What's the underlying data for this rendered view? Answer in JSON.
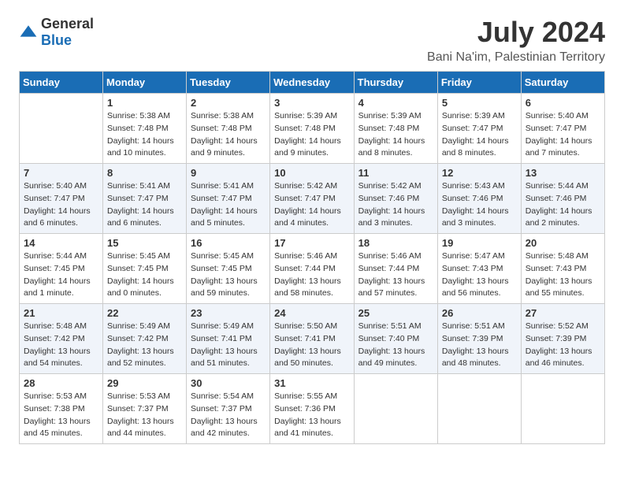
{
  "logo": {
    "general": "General",
    "blue": "Blue"
  },
  "title": "July 2024",
  "subtitle": "Bani Na'im, Palestinian Territory",
  "days_of_week": [
    "Sunday",
    "Monday",
    "Tuesday",
    "Wednesday",
    "Thursday",
    "Friday",
    "Saturday"
  ],
  "weeks": [
    {
      "shaded": false,
      "days": [
        {
          "num": "",
          "info": ""
        },
        {
          "num": "1",
          "info": "Sunrise: 5:38 AM\nSunset: 7:48 PM\nDaylight: 14 hours\nand 10 minutes."
        },
        {
          "num": "2",
          "info": "Sunrise: 5:38 AM\nSunset: 7:48 PM\nDaylight: 14 hours\nand 9 minutes."
        },
        {
          "num": "3",
          "info": "Sunrise: 5:39 AM\nSunset: 7:48 PM\nDaylight: 14 hours\nand 9 minutes."
        },
        {
          "num": "4",
          "info": "Sunrise: 5:39 AM\nSunset: 7:48 PM\nDaylight: 14 hours\nand 8 minutes."
        },
        {
          "num": "5",
          "info": "Sunrise: 5:39 AM\nSunset: 7:47 PM\nDaylight: 14 hours\nand 8 minutes."
        },
        {
          "num": "6",
          "info": "Sunrise: 5:40 AM\nSunset: 7:47 PM\nDaylight: 14 hours\nand 7 minutes."
        }
      ]
    },
    {
      "shaded": true,
      "days": [
        {
          "num": "7",
          "info": "Sunrise: 5:40 AM\nSunset: 7:47 PM\nDaylight: 14 hours\nand 6 minutes."
        },
        {
          "num": "8",
          "info": "Sunrise: 5:41 AM\nSunset: 7:47 PM\nDaylight: 14 hours\nand 6 minutes."
        },
        {
          "num": "9",
          "info": "Sunrise: 5:41 AM\nSunset: 7:47 PM\nDaylight: 14 hours\nand 5 minutes."
        },
        {
          "num": "10",
          "info": "Sunrise: 5:42 AM\nSunset: 7:47 PM\nDaylight: 14 hours\nand 4 minutes."
        },
        {
          "num": "11",
          "info": "Sunrise: 5:42 AM\nSunset: 7:46 PM\nDaylight: 14 hours\nand 3 minutes."
        },
        {
          "num": "12",
          "info": "Sunrise: 5:43 AM\nSunset: 7:46 PM\nDaylight: 14 hours\nand 3 minutes."
        },
        {
          "num": "13",
          "info": "Sunrise: 5:44 AM\nSunset: 7:46 PM\nDaylight: 14 hours\nand 2 minutes."
        }
      ]
    },
    {
      "shaded": false,
      "days": [
        {
          "num": "14",
          "info": "Sunrise: 5:44 AM\nSunset: 7:45 PM\nDaylight: 14 hours\nand 1 minute."
        },
        {
          "num": "15",
          "info": "Sunrise: 5:45 AM\nSunset: 7:45 PM\nDaylight: 14 hours\nand 0 minutes."
        },
        {
          "num": "16",
          "info": "Sunrise: 5:45 AM\nSunset: 7:45 PM\nDaylight: 13 hours\nand 59 minutes."
        },
        {
          "num": "17",
          "info": "Sunrise: 5:46 AM\nSunset: 7:44 PM\nDaylight: 13 hours\nand 58 minutes."
        },
        {
          "num": "18",
          "info": "Sunrise: 5:46 AM\nSunset: 7:44 PM\nDaylight: 13 hours\nand 57 minutes."
        },
        {
          "num": "19",
          "info": "Sunrise: 5:47 AM\nSunset: 7:43 PM\nDaylight: 13 hours\nand 56 minutes."
        },
        {
          "num": "20",
          "info": "Sunrise: 5:48 AM\nSunset: 7:43 PM\nDaylight: 13 hours\nand 55 minutes."
        }
      ]
    },
    {
      "shaded": true,
      "days": [
        {
          "num": "21",
          "info": "Sunrise: 5:48 AM\nSunset: 7:42 PM\nDaylight: 13 hours\nand 54 minutes."
        },
        {
          "num": "22",
          "info": "Sunrise: 5:49 AM\nSunset: 7:42 PM\nDaylight: 13 hours\nand 52 minutes."
        },
        {
          "num": "23",
          "info": "Sunrise: 5:49 AM\nSunset: 7:41 PM\nDaylight: 13 hours\nand 51 minutes."
        },
        {
          "num": "24",
          "info": "Sunrise: 5:50 AM\nSunset: 7:41 PM\nDaylight: 13 hours\nand 50 minutes."
        },
        {
          "num": "25",
          "info": "Sunrise: 5:51 AM\nSunset: 7:40 PM\nDaylight: 13 hours\nand 49 minutes."
        },
        {
          "num": "26",
          "info": "Sunrise: 5:51 AM\nSunset: 7:39 PM\nDaylight: 13 hours\nand 48 minutes."
        },
        {
          "num": "27",
          "info": "Sunrise: 5:52 AM\nSunset: 7:39 PM\nDaylight: 13 hours\nand 46 minutes."
        }
      ]
    },
    {
      "shaded": false,
      "days": [
        {
          "num": "28",
          "info": "Sunrise: 5:53 AM\nSunset: 7:38 PM\nDaylight: 13 hours\nand 45 minutes."
        },
        {
          "num": "29",
          "info": "Sunrise: 5:53 AM\nSunset: 7:37 PM\nDaylight: 13 hours\nand 44 minutes."
        },
        {
          "num": "30",
          "info": "Sunrise: 5:54 AM\nSunset: 7:37 PM\nDaylight: 13 hours\nand 42 minutes."
        },
        {
          "num": "31",
          "info": "Sunrise: 5:55 AM\nSunset: 7:36 PM\nDaylight: 13 hours\nand 41 minutes."
        },
        {
          "num": "",
          "info": ""
        },
        {
          "num": "",
          "info": ""
        },
        {
          "num": "",
          "info": ""
        }
      ]
    }
  ]
}
